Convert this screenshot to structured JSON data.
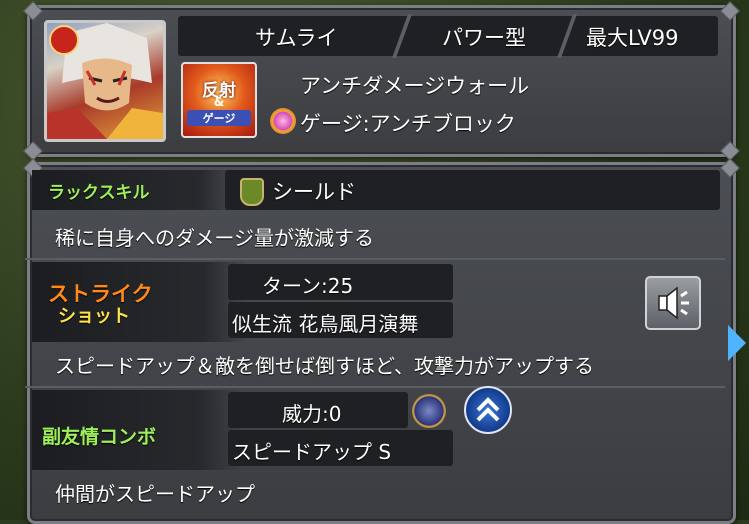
{
  "header": {
    "type_label": "サムライ",
    "style_label": "パワー型",
    "max_level": "最大LV99",
    "ability_name": "アンチダメージウォール",
    "gauge_text": "ゲージ:アンチブロック",
    "badge_line1": "反射",
    "badge_line2": "&",
    "badge_line3": "ゲージ"
  },
  "luck_skill": {
    "label": "ラックスキル",
    "name": "シールド",
    "description": "稀に自身へのダメージ量が激減する"
  },
  "strike_shot": {
    "label_line1": "ストライク",
    "label_line2": "ショット",
    "turns": "ターン:25",
    "name": "似生流 花鳥風月演舞",
    "description": "スピードアップ＆敵を倒せば倒すほど、攻撃力がアップする"
  },
  "sub_combo": {
    "label": "副友情コンボ",
    "power": "威力:0",
    "name": "スピードアップ S",
    "description": "仲間がスピードアップ"
  },
  "colors": {
    "accent_green": "#9df05a",
    "strike_orange": "#ff8a1a",
    "strike_yellow": "#ffe34a"
  },
  "icons": {
    "speaker": "speaker-icon",
    "shield": "shield-icon",
    "speed_up": "speed-up-icon",
    "element_fire": "fire-element-icon"
  }
}
